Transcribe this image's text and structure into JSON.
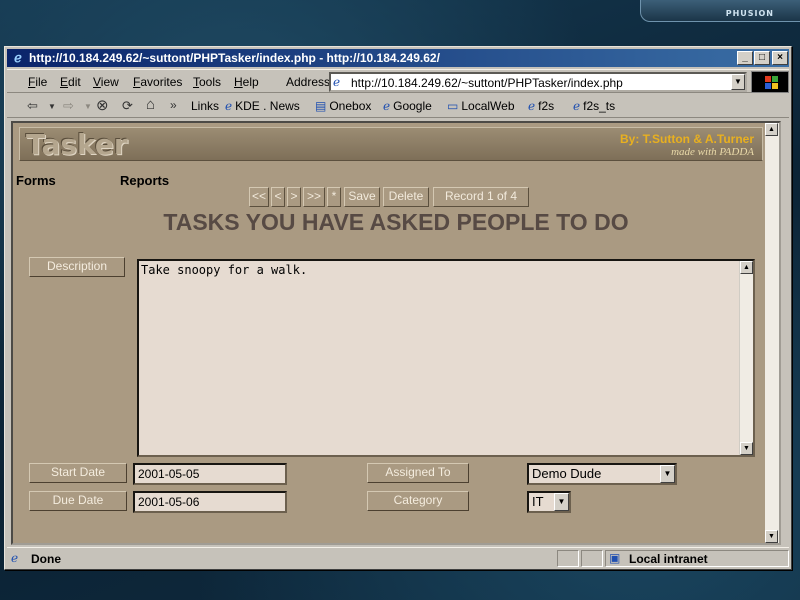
{
  "desktop": {
    "badge": "PHUSION"
  },
  "window": {
    "title": "http://10.184.249.62/~suttont/PHPTasker/index.php - http://10.184.249.62/",
    "buttons": {
      "minimize": "_",
      "maximize": "□",
      "close": "×"
    }
  },
  "menu": {
    "items": [
      {
        "key": "F",
        "rest": "ile"
      },
      {
        "key": "E",
        "rest": "dit"
      },
      {
        "key": "V",
        "rest": "iew"
      },
      {
        "key": "F",
        "rest": "avorites"
      },
      {
        "key": "T",
        "rest": "ools"
      },
      {
        "key": "H",
        "rest": "elp"
      }
    ],
    "address_label": "Address",
    "address_value": "http://10.184.249.62/~suttont/PHPTasker/index.php"
  },
  "toolbar": {
    "back": "⇦",
    "forward": "⇨",
    "stop": "⊗",
    "refresh": "⟳",
    "home": "⌂",
    "more": "»",
    "links_label": "Links",
    "links": [
      "KDE . News",
      "Onebox",
      "Google",
      "LocalWeb",
      "f2s",
      "f2s_ts"
    ]
  },
  "app": {
    "banner_title": "Tasker",
    "banner_credit": "By: T.Sutton & A.Turner",
    "banner_made_with": "made with PADDA",
    "nav": {
      "forms": "Forms",
      "reports": "Reports"
    },
    "record_nav": {
      "first": "<<",
      "prev": "<",
      "next": ">",
      "last": ">>",
      "new": "*",
      "save": "Save",
      "delete": "Delete",
      "record_label": "Record 1 of 4"
    },
    "heading": "TASKS YOU HAVE ASKED PEOPLE TO DO",
    "labels": {
      "description": "Description",
      "start_date": "Start Date",
      "due_date": "Due Date",
      "assigned_to": "Assigned To",
      "category": "Category"
    },
    "values": {
      "description": "Take snoopy for a walk.",
      "start_date": "2001-05-05",
      "due_date": "2001-05-06",
      "assigned_to": "Demo Dude",
      "category": "IT"
    }
  },
  "status": {
    "text": "Done",
    "zone": "Local intranet"
  }
}
